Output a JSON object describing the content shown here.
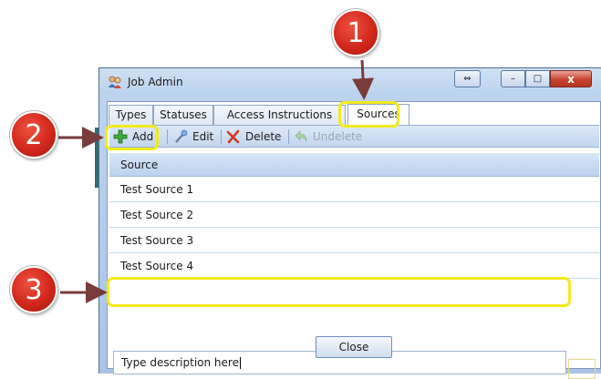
{
  "window": {
    "title": "Job Admin",
    "controls": {
      "resize": "⇔",
      "minimize": "–",
      "maximize": "□",
      "close": "x"
    }
  },
  "tabs": [
    {
      "label": "Types",
      "active": false
    },
    {
      "label": "Statuses",
      "active": false
    },
    {
      "label": "Access Instructions",
      "active": false
    },
    {
      "label": "Sources",
      "active": true
    }
  ],
  "toolbar": {
    "add_label": "Add",
    "edit_label": "Edit",
    "delete_label": "Delete",
    "undelete_label": "Undelete"
  },
  "grid": {
    "column_header": "Source",
    "rows": [
      "Test Source 1",
      "Test Source 2",
      "Test Source 3",
      "Test Source 4"
    ],
    "new_row_value": "Type description here"
  },
  "footer": {
    "close_label": "Close"
  },
  "callouts": {
    "one": "1",
    "two": "2",
    "three": "3"
  },
  "colors": {
    "callout_red": "#d1281c",
    "highlight_yellow": "#f2ea1e",
    "arrow": "#7a3b3b"
  }
}
